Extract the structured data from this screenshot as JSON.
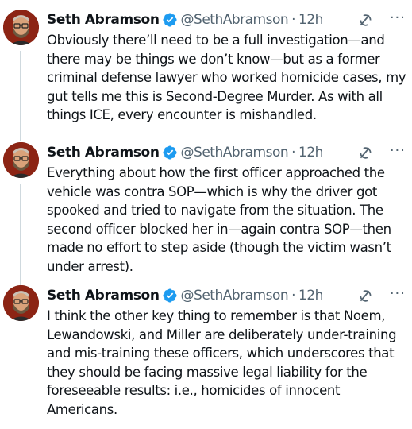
{
  "tweets": [
    {
      "name": "Seth Abramson",
      "handle": "@SethAbramson",
      "separator": "·",
      "time": "12h",
      "more_label": "···",
      "text": "Obviously there’ll need to be a full investigation—and there may be things we don’t know—but as a former criminal defense lawyer who worked homicide cases, my gut tells me this is Second-Degree Murder. As with all things ICE, every encounter is mishandled."
    },
    {
      "name": "Seth Abramson",
      "handle": "@SethAbramson",
      "separator": "·",
      "time": "12h",
      "more_label": "···",
      "text": "Everything about how the first officer approached the vehicle was contra SOP—which is why the driver got spooked and tried to navigate from the situation. The second officer blocked her in—again contra SOP—then made no effort to step aside (though the victim wasn’t under arrest)."
    },
    {
      "name": "Seth Abramson",
      "handle": "@SethAbramson",
      "separator": "·",
      "time": "12h",
      "more_label": "···",
      "text": "I think the other key thing to remember is that Noem, Lewandowski, and Miller are deliberately under-training and mis-training these officers, which underscores that they should be facing massive legal liability for the foreseeable results: i.e., homicides of innocent Americans."
    }
  ],
  "colors": {
    "text": "#0f1419",
    "secondary": "#536471",
    "verified": "#1d9bf0",
    "thread_line": "#cfd9de"
  },
  "icons": [
    "verified-badge-icon",
    "grok-icon",
    "more-options-icon"
  ]
}
